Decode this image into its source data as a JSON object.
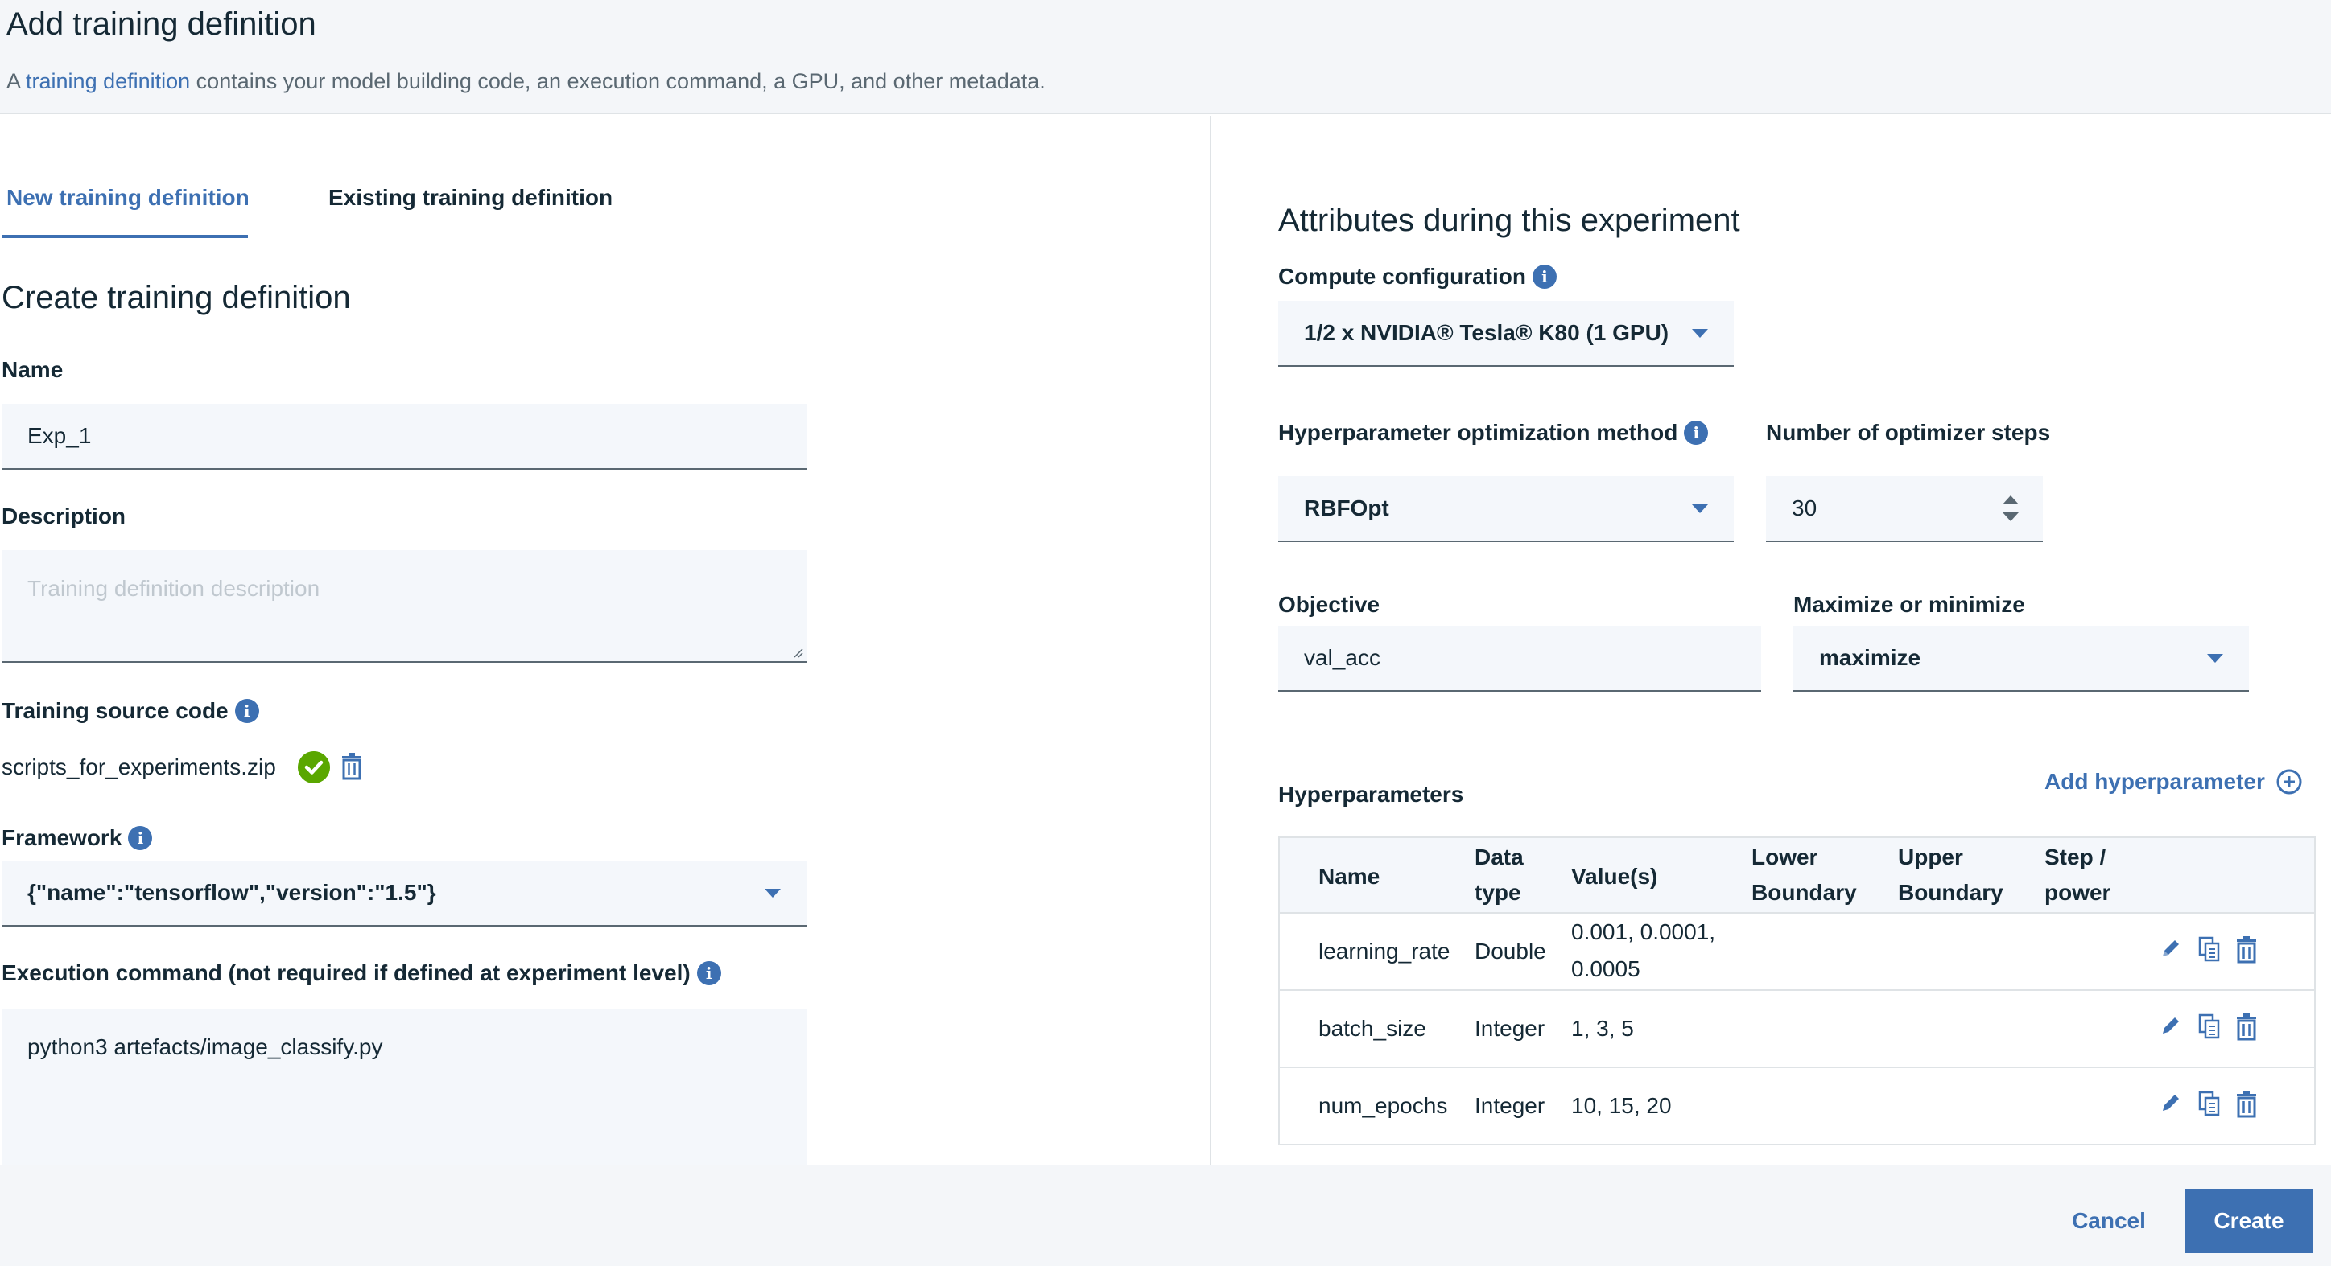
{
  "header": {
    "title": "Add training definition",
    "subtitle_prefix": "A ",
    "subtitle_link": "training definition",
    "subtitle_rest": " contains your model building code,  an execution command, a GPU, and other metadata."
  },
  "tabs": [
    {
      "label": "New training definition",
      "active": true
    },
    {
      "label": "Existing training definition",
      "active": false
    }
  ],
  "left": {
    "section_title": "Create training definition",
    "name_label": "Name",
    "name_value": "Exp_1",
    "description_label": "Description",
    "description_placeholder": "Training definition description",
    "source_label": "Training source code",
    "source_file": "scripts_for_experiments.zip",
    "framework_label": "Framework",
    "framework_value": "{\"name\":\"tensorflow\",\"version\":\"1.5\"}",
    "exec_label": "Execution command (not required if defined at experiment level)",
    "exec_value": "python3 artefacts/image_classify.py"
  },
  "right": {
    "section_title": "Attributes during this experiment",
    "compute_label": "Compute configuration",
    "compute_value": "1/2 x NVIDIA® Tesla® K80 (1 GPU)",
    "hpo_label": "Hyperparameter optimization method",
    "hpo_value": "RBFOpt",
    "steps_label": "Number of optimizer steps",
    "steps_value": "30",
    "objective_label": "Objective",
    "objective_value": "val_acc",
    "maxmin_label": "Maximize or minimize",
    "maxmin_value": "maximize",
    "hp_label": "Hyperparameters",
    "add_hp_label": "Add hyperparameter"
  },
  "hp_table": {
    "columns": {
      "name": "Name",
      "dtype_1": "Data",
      "dtype_2": "type",
      "values": "Value(s)",
      "lower_1": "Lower",
      "lower_2": "Boundary",
      "upper_1": "Upper",
      "upper_2": "Boundary",
      "step_1": "Step /",
      "step_2": "power"
    },
    "rows": [
      {
        "name": "learning_rate",
        "dtype": "Double",
        "values_1": "0.001, 0.0001,",
        "values_2": "0.0005"
      },
      {
        "name": "batch_size",
        "dtype": "Integer",
        "values_1": "1, 3, 5",
        "values_2": ""
      },
      {
        "name": "num_epochs",
        "dtype": "Integer",
        "values_1": "10, 15, 20",
        "values_2": ""
      }
    ]
  },
  "footer": {
    "cancel_label": "Cancel",
    "create_label": "Create"
  },
  "colors": {
    "accent": "#3d70b2",
    "success": "#5aa700",
    "text": "#152935",
    "field_bg": "#f4f7fb"
  }
}
